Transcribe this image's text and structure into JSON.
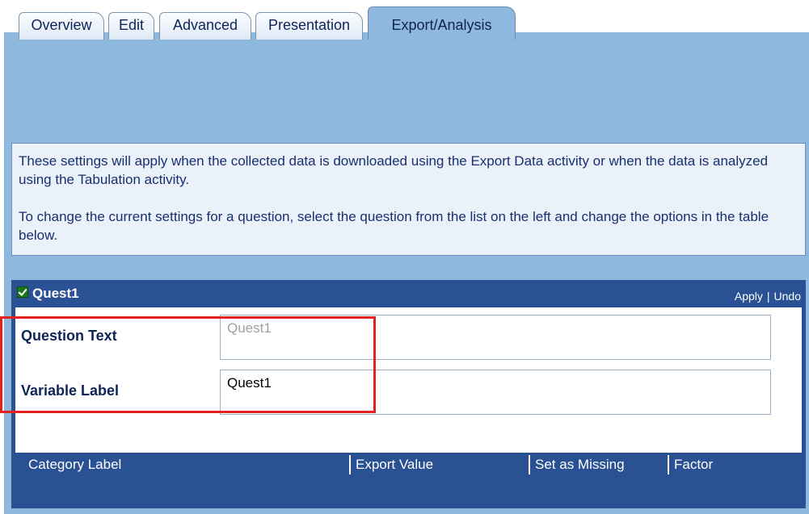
{
  "tabs": [
    {
      "label": "Overview"
    },
    {
      "label": "Edit"
    },
    {
      "label": "Advanced"
    },
    {
      "label": "Presentation"
    },
    {
      "label": "Export/Analysis"
    }
  ],
  "active_tab": "Export/Analysis",
  "info": {
    "paragraph1": "These settings will apply when the collected data is downloaded using the Export Data activity or when the data is analyzed using the Tabulation activity.",
    "paragraph2": "To change the current settings for a question, select the question from the list on the left and change the options in the table below."
  },
  "panel": {
    "title": "Quest1",
    "checkbox_checked": true,
    "apply_label": "Apply",
    "separator": "|",
    "undo_label": "Undo"
  },
  "fields": {
    "question_text": {
      "label": "Question Text",
      "value": "Quest1"
    },
    "variable_label": {
      "label": "Variable Label",
      "value": "Quest1"
    }
  },
  "grid": {
    "columns": [
      "Category Label",
      "Export Value",
      "Set as Missing",
      "Factor"
    ]
  },
  "colors": {
    "workspace": "#8fb8df",
    "panel": "#2a5193",
    "highlight": "#e4211f",
    "check": "#1a7a1a"
  }
}
